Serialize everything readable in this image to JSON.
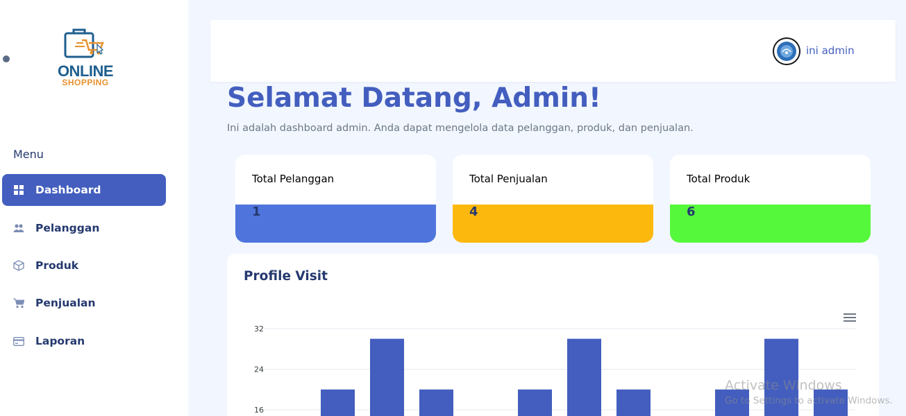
{
  "brand": {
    "line1": "ONLINE",
    "line2": "SHOPPING"
  },
  "sidebar": {
    "menu_title": "Menu",
    "items": [
      {
        "label": "Dashboard",
        "icon": "grid-icon",
        "active": true
      },
      {
        "label": "Pelanggan",
        "icon": "users-icon",
        "active": false
      },
      {
        "label": "Produk",
        "icon": "box-icon",
        "active": false
      },
      {
        "label": "Penjualan",
        "icon": "cart-icon",
        "active": false
      },
      {
        "label": "Laporan",
        "icon": "card-icon",
        "active": false
      }
    ]
  },
  "header": {
    "user_name": "ini admin"
  },
  "main": {
    "welcome": "Selamat Datang, Admin!",
    "subtitle": "Ini adalah dashboard admin. Anda dapat mengelola data pelanggan, produk, dan penjualan."
  },
  "stats": [
    {
      "label": "Total Pelanggan",
      "value": "1",
      "color": "#4f75dd"
    },
    {
      "label": "Total Penjualan",
      "value": "4",
      "color": "#fdb80e"
    },
    {
      "label": "Total Produk",
      "value": "6",
      "color": "#56f83b"
    }
  ],
  "chart": {
    "title": "Profile Visit",
    "bar_color": "#435ebe"
  },
  "chart_data": {
    "type": "bar",
    "title": "Profile Visit",
    "yticks": [
      "32",
      "24",
      "16"
    ],
    "ylim_visible": [
      16,
      32
    ],
    "values": [
      null,
      20,
      30,
      20,
      null,
      20,
      30,
      20,
      null,
      20,
      30,
      20
    ],
    "grid": true
  },
  "watermark": {
    "title": "Activate Windows",
    "subtitle": "Go to Settings to activate Windows."
  }
}
